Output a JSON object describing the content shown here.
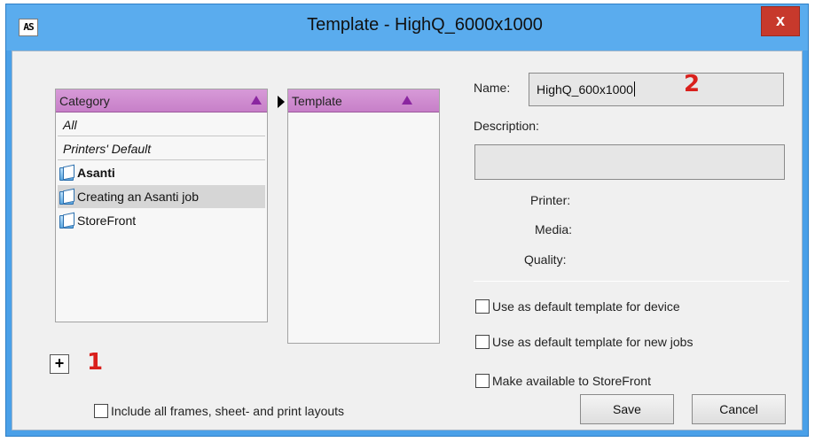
{
  "window": {
    "app_icon_text": "AS",
    "title": "Template - HighQ_6000x1000",
    "close_label": "x"
  },
  "category_panel": {
    "header": "Category",
    "items": [
      {
        "label": "All",
        "style": "italic",
        "icon": null
      },
      {
        "label": "Printers' Default",
        "style": "italic",
        "icon": null
      },
      {
        "label": "Asanti",
        "style": "bold",
        "icon": "folder-icon"
      },
      {
        "label": "Creating an Asanti job",
        "style": "selected",
        "icon": "folder-icon"
      },
      {
        "label": "StoreFront",
        "style": "normal",
        "icon": "folder-icon"
      }
    ]
  },
  "template_panel": {
    "header": "Template"
  },
  "annotations": {
    "marker_1": "1",
    "marker_2": "2"
  },
  "add_button_label": "+",
  "details": {
    "name_label": "Name:",
    "name_value": "HighQ_600x1000",
    "description_label": "Description:",
    "description_value": "",
    "printer_label": "Printer:",
    "media_label": "Media:",
    "quality_label": "Quality:"
  },
  "options": {
    "default_device": "Use as default template for device",
    "default_new_jobs": "Use as default template for new jobs",
    "storefront": "Make available to StoreFront",
    "include_frames": "Include all frames, sheet- and print layouts"
  },
  "buttons": {
    "save": "Save",
    "cancel": "Cancel"
  },
  "colors": {
    "title_bar": "#5aacee",
    "panel_header": "#c77fc8",
    "close_button": "#c7392c",
    "marker": "#d9201c"
  }
}
